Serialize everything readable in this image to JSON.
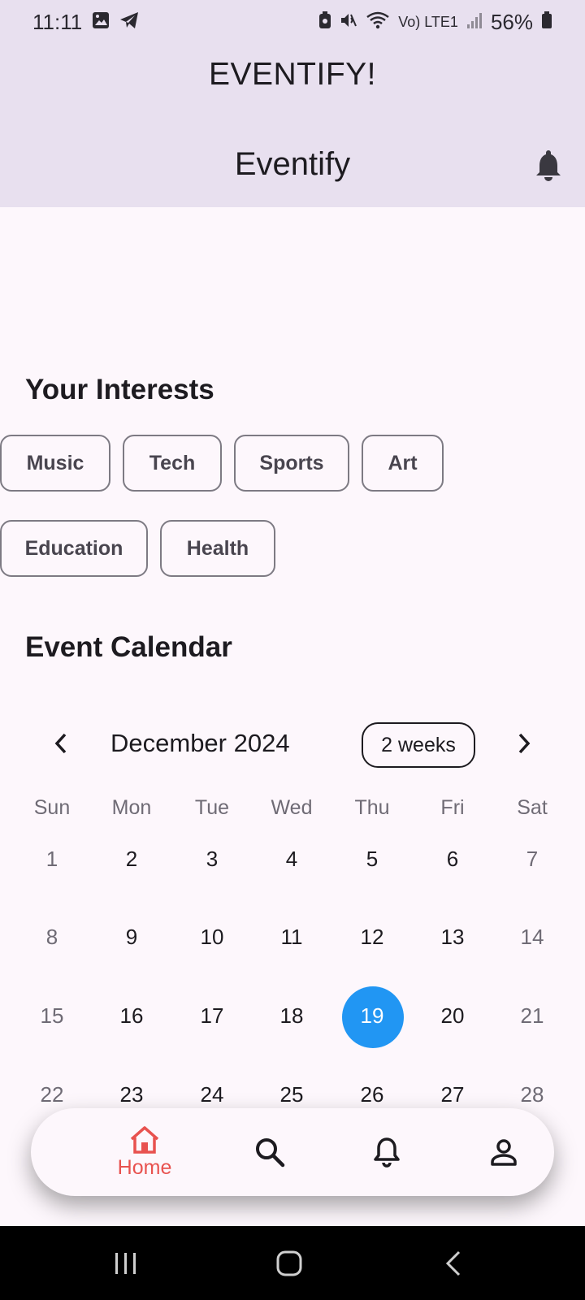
{
  "status_bar": {
    "time": "11:11",
    "lte_label": "Vo) LTE1",
    "battery": "56%"
  },
  "app": {
    "title": "EVENTIFY!",
    "appbar_title": "Eventify"
  },
  "interests": {
    "heading": "Your Interests",
    "chips": [
      "Music",
      "Tech",
      "Sports",
      "Art",
      "Education",
      "Health"
    ]
  },
  "calendar": {
    "heading": "Event Calendar",
    "month_label": "December 2024",
    "format_button": "2 weeks",
    "weekdays": [
      "Sun",
      "Mon",
      "Tue",
      "Wed",
      "Thu",
      "Fri",
      "Sat"
    ],
    "weeks": [
      [
        "1",
        "2",
        "3",
        "4",
        "5",
        "6",
        "7"
      ],
      [
        "8",
        "9",
        "10",
        "11",
        "12",
        "13",
        "14"
      ],
      [
        "15",
        "16",
        "17",
        "18",
        "19",
        "20",
        "21"
      ],
      [
        "22",
        "23",
        "24",
        "25",
        "26",
        "27",
        "28"
      ]
    ],
    "selected_day": "19",
    "selected_color": "#2196f3"
  },
  "bottom_nav": {
    "home_label": "Home",
    "active_color": "#e8524f",
    "items": [
      "home-icon",
      "search-icon",
      "bell-icon",
      "person-icon"
    ]
  },
  "colors": {
    "header_bg": "#e8e0ef",
    "page_bg": "#fdf7fc"
  }
}
